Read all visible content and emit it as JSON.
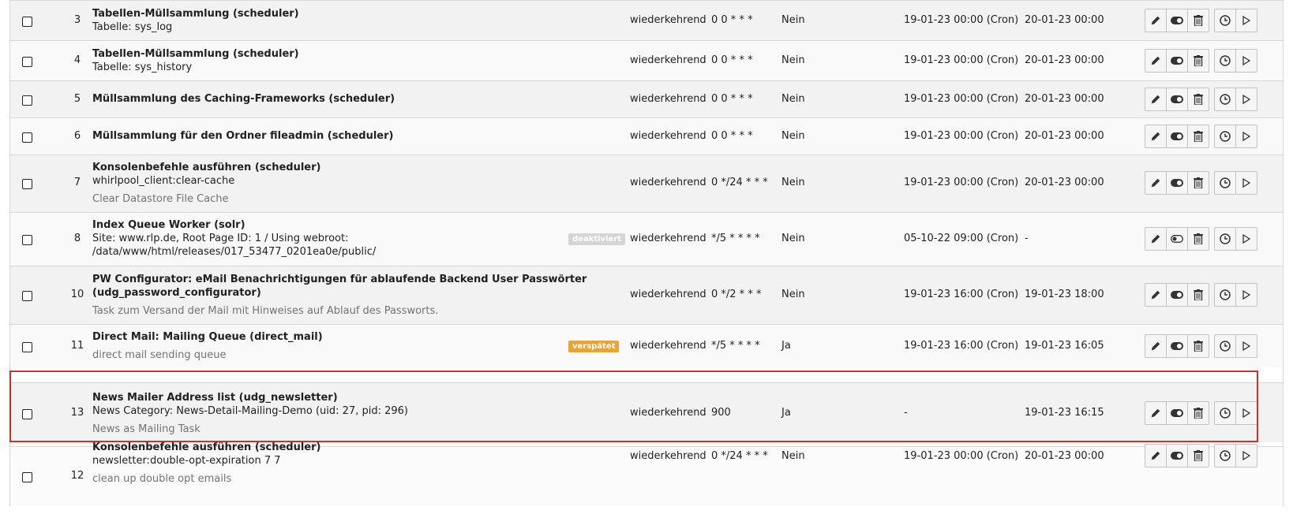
{
  "colors": {
    "highlight": "#d32f2f",
    "badge_deactivated": "#d5d5d5",
    "badge_late": "#e8a33d"
  },
  "rows": [
    {
      "uid": "3",
      "title": "Tabellen-Müllsammlung (scheduler)",
      "sub": "Tabelle: sys_log",
      "sub2": "",
      "desc": "",
      "badge": "",
      "type": "wiederkehrend",
      "frequency": "0 0 * * *",
      "parallel": "Nein",
      "last_run": "19-01-23 00:00 (Cron)",
      "next_run": "20-01-23 00:00"
    },
    {
      "uid": "4",
      "title": "Tabellen-Müllsammlung (scheduler)",
      "sub": "Tabelle: sys_history",
      "sub2": "",
      "desc": "",
      "badge": "",
      "type": "wiederkehrend",
      "frequency": "0 0 * * *",
      "parallel": "Nein",
      "last_run": "19-01-23 00:00 (Cron)",
      "next_run": "20-01-23 00:00"
    },
    {
      "uid": "5",
      "title": "Müllsammlung des Caching-Frameworks (scheduler)",
      "sub": "",
      "sub2": "",
      "desc": "",
      "badge": "",
      "type": "wiederkehrend",
      "frequency": "0 0 * * *",
      "parallel": "Nein",
      "last_run": "19-01-23 00:00 (Cron)",
      "next_run": "20-01-23 00:00"
    },
    {
      "uid": "6",
      "title": "Müllsammlung für den Ordner fileadmin (scheduler)",
      "sub": "",
      "sub2": "",
      "desc": "",
      "badge": "",
      "type": "wiederkehrend",
      "frequency": "0 0 * * *",
      "parallel": "Nein",
      "last_run": "19-01-23 00:00 (Cron)",
      "next_run": "20-01-23 00:00"
    },
    {
      "uid": "7",
      "title": "Konsolenbefehle ausführen (scheduler)",
      "sub": "whirlpool_client:clear-cache",
      "sub2": "",
      "desc": "Clear Datastore File Cache",
      "badge": "",
      "type": "wiederkehrend",
      "frequency": "0 */24 * * *",
      "parallel": "Nein",
      "last_run": "19-01-23 00:00 (Cron)",
      "next_run": "20-01-23 00:00"
    },
    {
      "uid": "8",
      "title": "Index Queue Worker (solr)",
      "sub": "Site: www.rlp.de, Root Page ID: 1 / Using webroot:",
      "sub2": "/data/www/html/releases/017_53477_0201ea0e/public/",
      "desc": "",
      "badge": "deaktiviert",
      "type": "wiederkehrend",
      "frequency": "*/5 * * * *",
      "parallel": "Nein",
      "last_run": "05-10-22 09:00 (Cron)",
      "next_run": "-"
    },
    {
      "uid": "10",
      "title": "PW Configurator: eMail Benachrichtigungen für ablaufende Backend User Passwörter",
      "sub": "",
      "title2": "(udg_password_configurator)",
      "sub2": "",
      "desc": "Task zum Versand der Mail mit Hinweises auf Ablauf des Passworts.",
      "badge": "",
      "type": "wiederkehrend",
      "frequency": "0 */2 * * *",
      "parallel": "Nein",
      "last_run": "19-01-23 16:00 (Cron)",
      "next_run": "19-01-23 18:00"
    },
    {
      "uid": "11",
      "title": "Direct Mail: Mailing Queue (direct_mail)",
      "sub": "",
      "sub2": "",
      "desc": "direct mail sending queue",
      "badge": "verspätet",
      "type": "wiederkehrend",
      "frequency": "*/5 * * * *",
      "parallel": "Ja",
      "last_run": "19-01-23 16:00 (Cron)",
      "next_run": "19-01-23 16:05"
    },
    {
      "uid": "13",
      "title": "News Mailer Address list (udg_newsletter)",
      "sub": "News Category: News-Detail-Mailing-Demo (uid: 27, pid: 296)",
      "sub2": "",
      "desc": "News as Mailing Task",
      "badge": "",
      "type": "wiederkehrend",
      "frequency": "900",
      "parallel": "Ja",
      "last_run": "-",
      "next_run": "19-01-23 16:15"
    },
    {
      "uid": "12",
      "title": "Konsolenbefehle ausführen (scheduler)",
      "sub": "newsletter:double-opt-expiration 7 7",
      "sub2": "",
      "desc": "clean up double opt emails",
      "badge": "",
      "type": "wiederkehrend",
      "frequency": "0 */24 * * *",
      "parallel": "Nein",
      "last_run": "19-01-23 00:00 (Cron)",
      "next_run": "20-01-23 00:00"
    }
  ],
  "icons": {
    "edit": "pencil-icon",
    "toggle": "toggle-icon",
    "delete": "trash-icon",
    "schedule": "clock-icon",
    "run": "play-icon"
  }
}
